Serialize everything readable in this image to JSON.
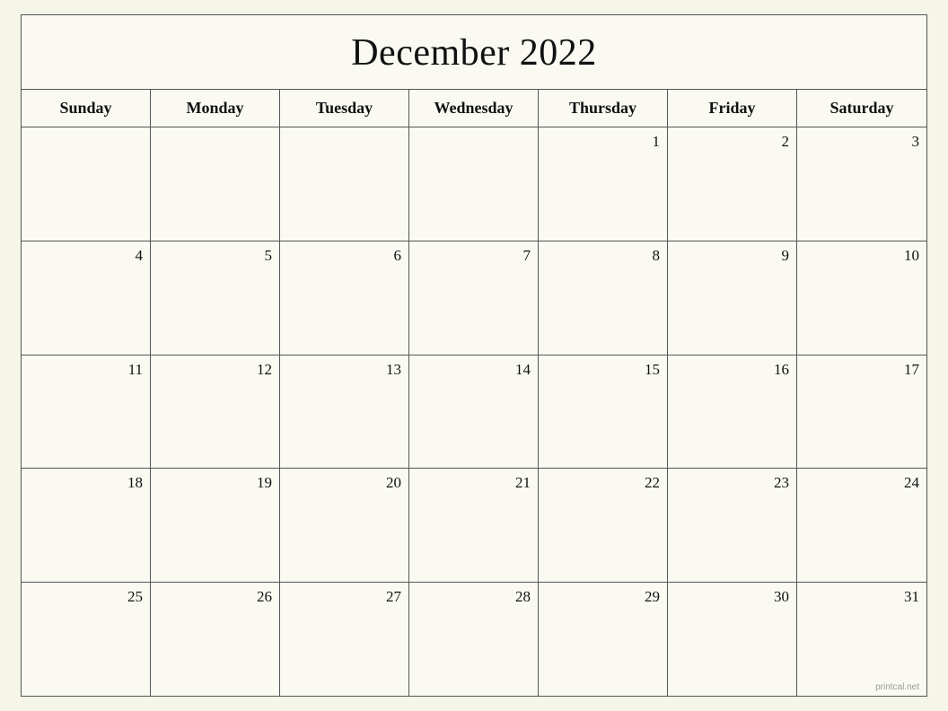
{
  "calendar": {
    "title": "December 2022",
    "days_of_week": [
      "Sunday",
      "Monday",
      "Tuesday",
      "Wednesday",
      "Thursday",
      "Friday",
      "Saturday"
    ],
    "weeks": [
      [
        null,
        null,
        null,
        null,
        1,
        2,
        3
      ],
      [
        4,
        5,
        6,
        7,
        8,
        9,
        10
      ],
      [
        11,
        12,
        13,
        14,
        15,
        16,
        17
      ],
      [
        18,
        19,
        20,
        21,
        22,
        23,
        24
      ],
      [
        25,
        26,
        27,
        28,
        29,
        30,
        31
      ]
    ],
    "watermark": "printcal.net"
  }
}
